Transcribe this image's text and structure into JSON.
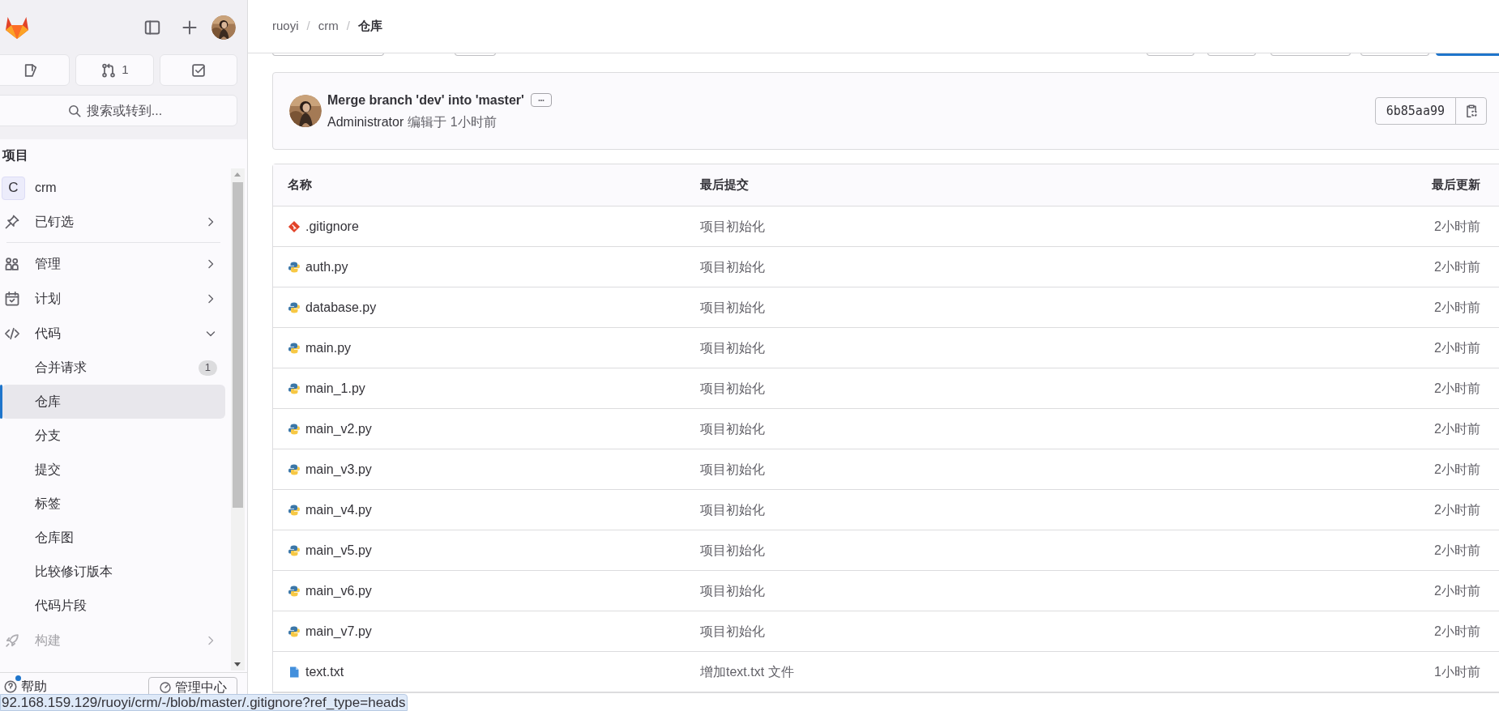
{
  "sidebar": {
    "quick_buttons": [
      {
        "kind": "issues"
      },
      {
        "kind": "merge",
        "count": "1"
      },
      {
        "kind": "todo"
      }
    ],
    "search": {
      "placeholder": "搜索或转到..."
    },
    "heading": "项目",
    "project": {
      "letter": "C",
      "name": "crm"
    },
    "nav": [
      {
        "label": "已钉选",
        "expanded": false,
        "selected": false
      },
      {
        "label": "管理",
        "expanded": false,
        "selected": false
      },
      {
        "label": "计划",
        "expanded": false,
        "selected": false
      },
      {
        "label": "代码",
        "expanded": true,
        "selected": false,
        "children": [
          {
            "label": "合并请求",
            "badge": "1",
            "selected": false
          },
          {
            "label": "仓库",
            "selected": true
          },
          {
            "label": "分支",
            "selected": false
          },
          {
            "label": "提交",
            "selected": false
          },
          {
            "label": "标签",
            "selected": false
          },
          {
            "label": "仓库图",
            "selected": false
          },
          {
            "label": "比较修订版本",
            "selected": false
          },
          {
            "label": "代码片段",
            "selected": false
          }
        ]
      },
      {
        "label": "构建",
        "expanded": false,
        "selected": false
      }
    ],
    "footer": {
      "help": "帮助",
      "admin": "管理中心"
    }
  },
  "breadcrumb": {
    "separator": "/",
    "items": [
      "ruoyi",
      "crm",
      "仓库"
    ]
  },
  "commit": {
    "title": "Merge branch 'dev' into 'master'",
    "author": "Administrator",
    "meta": "编辑于 1小时前",
    "sha": "6b85aa99"
  },
  "table": {
    "columns": [
      "名称",
      "最后提交",
      "最后更新"
    ],
    "rows": [
      {
        "kind": "git",
        "name": ".gitignore",
        "commit": "项目初始化",
        "updated": "2小时前"
      },
      {
        "kind": "python",
        "name": "auth.py",
        "commit": "项目初始化",
        "updated": "2小时前"
      },
      {
        "kind": "python",
        "name": "database.py",
        "commit": "项目初始化",
        "updated": "2小时前"
      },
      {
        "kind": "python",
        "name": "main.py",
        "commit": "项目初始化",
        "updated": "2小时前"
      },
      {
        "kind": "python",
        "name": "main_1.py",
        "commit": "项目初始化",
        "updated": "2小时前"
      },
      {
        "kind": "python",
        "name": "main_v2.py",
        "commit": "项目初始化",
        "updated": "2小时前"
      },
      {
        "kind": "python",
        "name": "main_v3.py",
        "commit": "项目初始化",
        "updated": "2小时前"
      },
      {
        "kind": "python",
        "name": "main_v4.py",
        "commit": "项目初始化",
        "updated": "2小时前"
      },
      {
        "kind": "python",
        "name": "main_v5.py",
        "commit": "项目初始化",
        "updated": "2小时前"
      },
      {
        "kind": "python",
        "name": "main_v6.py",
        "commit": "项目初始化",
        "updated": "2小时前"
      },
      {
        "kind": "python",
        "name": "main_v7.py",
        "commit": "项目初始化",
        "updated": "2小时前"
      },
      {
        "kind": "text",
        "name": "text.txt",
        "commit": "增加text.txt 文件",
        "updated": "1小时前"
      }
    ]
  },
  "status_url": "92.168.159.129/ruoyi/crm/-/blob/master/.gitignore?ref_type=heads"
}
